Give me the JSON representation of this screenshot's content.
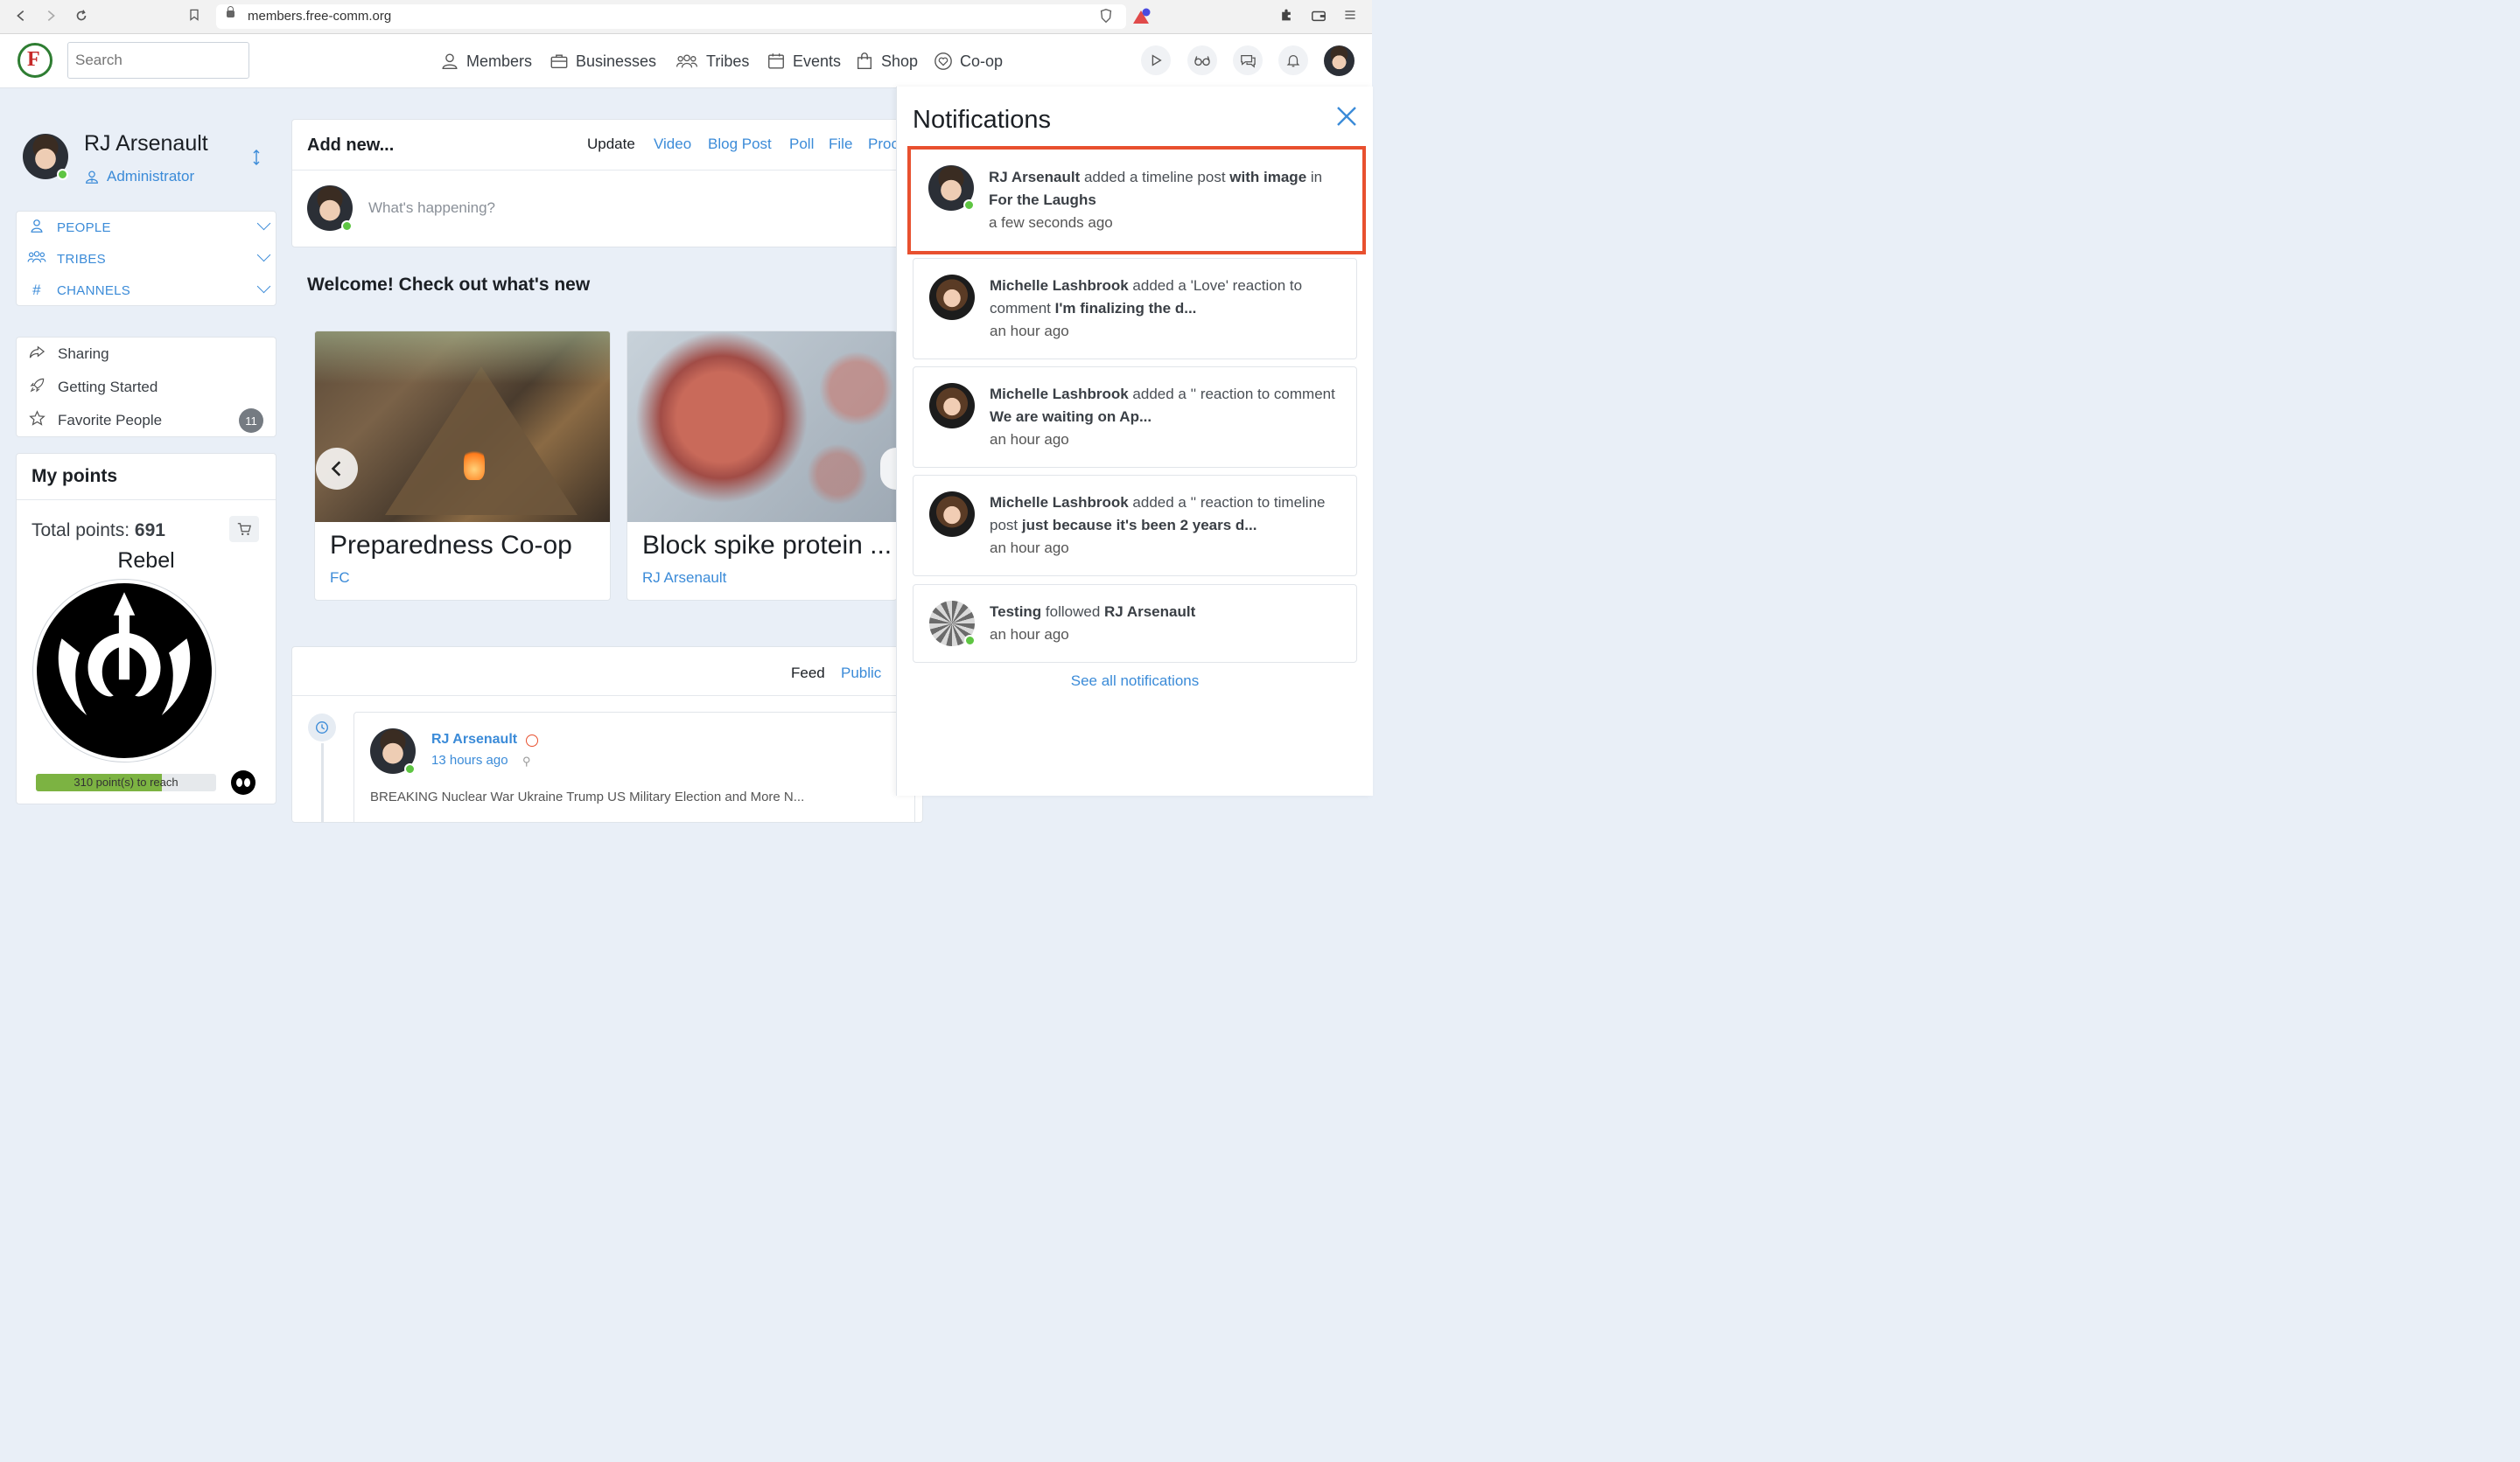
{
  "browser": {
    "url": "members.free-comm.org"
  },
  "header": {
    "logo_letter": "F",
    "search_placeholder": "Search",
    "nav": [
      {
        "label": "Members",
        "icon": "person-icon"
      },
      {
        "label": "Businesses",
        "icon": "briefcase-icon"
      },
      {
        "label": "Tribes",
        "icon": "group-icon"
      },
      {
        "label": "Events",
        "icon": "calendar-icon"
      },
      {
        "label": "Shop",
        "icon": "bag-icon"
      },
      {
        "label": "Co-op",
        "icon": "heart-icon"
      }
    ]
  },
  "profile": {
    "name": "RJ Arsenault",
    "role": "Administrator"
  },
  "sidebar_groups": [
    {
      "label": "PEOPLE"
    },
    {
      "label": "TRIBES"
    },
    {
      "label": "CHANNELS"
    }
  ],
  "sidebar_links": [
    {
      "label": "Sharing"
    },
    {
      "label": "Getting Started"
    },
    {
      "label": "Favorite People",
      "badge": "11"
    }
  ],
  "points": {
    "title": "My points",
    "total_label": "Total points:",
    "total_value": "691",
    "rank": "Rebel",
    "progress_text": "310 point(s) to reach",
    "progress_fraction": 0.7
  },
  "composer": {
    "title": "Add new...",
    "tabs": [
      "Update",
      "Video",
      "Blog Post",
      "Poll",
      "File",
      "Proc"
    ],
    "placeholder": "What's happening?"
  },
  "welcome": {
    "title": "Welcome! Check out what's new",
    "slides": [
      {
        "title": "Preparedness Co-op",
        "author": "FC"
      },
      {
        "title": "Block spike protein ...",
        "author": "RJ Arsenault"
      }
    ]
  },
  "feed": {
    "tabs": [
      "Feed",
      "Public"
    ],
    "post": {
      "author": "RJ Arsenault",
      "time": "13 hours ago",
      "text_preview": "BREAKING Nuclear War Ukraine Trump US Military Election and More N..."
    }
  },
  "notifications": {
    "title": "Notifications",
    "see_all": "See all notifications",
    "items": [
      {
        "actor": "RJ Arsenault",
        "middle": " added a timeline post ",
        "bold2": "with image",
        "tail": " in ",
        "target": "For the Laughs",
        "time": "a few seconds ago",
        "avatar": "rj",
        "online": true
      },
      {
        "actor": "Michelle Lashbrook",
        "middle": " added a 'Love' reaction to comment ",
        "bold2": "",
        "tail": "",
        "target": "I'm finalizing the d...",
        "time": "an hour ago",
        "avatar": "michelle",
        "online": false
      },
      {
        "actor": "Michelle Lashbrook",
        "middle": " added a '' reaction to comment ",
        "bold2": "",
        "tail": "",
        "target": "We are waiting on Ap...",
        "time": "an hour ago",
        "avatar": "michelle",
        "online": false
      },
      {
        "actor": "Michelle Lashbrook",
        "middle": " added a '' reaction to timeline post ",
        "bold2": "",
        "tail": "",
        "target": "just because it's been 2 years d...",
        "time": "an hour ago",
        "avatar": "michelle",
        "online": false
      },
      {
        "actor": "Testing",
        "middle": " followed ",
        "bold2": "",
        "tail": "",
        "target": "RJ Arsenault",
        "time": "an hour ago",
        "avatar": "testing",
        "online": true
      }
    ]
  },
  "colors": {
    "accent": "#3b8bd8",
    "highlight": "#e8502f",
    "progress": "#7cb342"
  }
}
